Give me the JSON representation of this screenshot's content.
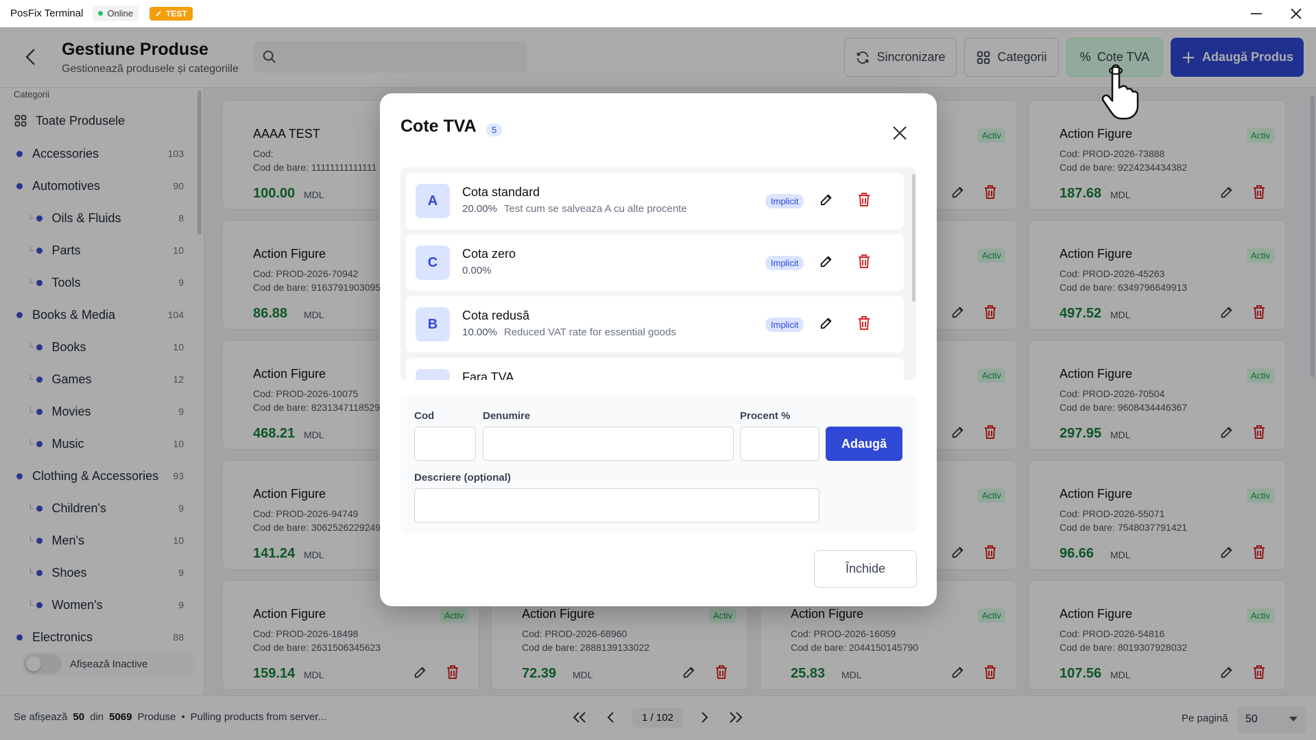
{
  "titlebar": {
    "app_title": "PosFix Terminal",
    "status": "Online",
    "env_badge": "TEST"
  },
  "header": {
    "title": "Gestiune Produse",
    "subtitle": "Gestionează produsele și categoriile",
    "search_placeholder": ""
  },
  "buttons": {
    "sync": "Sincronizare",
    "categories": "Categorii",
    "vat": "Cote TVA",
    "add_product": "Adaugă Produs"
  },
  "sidebar": {
    "label": "Categorii",
    "all_products": "Toate Produsele",
    "items": [
      {
        "label": "Accessories",
        "count": "103",
        "child": false
      },
      {
        "label": "Automotives",
        "count": "90",
        "child": false
      },
      {
        "label": "Oils & Fluids",
        "count": "8",
        "child": true
      },
      {
        "label": "Parts",
        "count": "10",
        "child": true
      },
      {
        "label": "Tools",
        "count": "9",
        "child": true
      },
      {
        "label": "Books & Media",
        "count": "104",
        "child": false
      },
      {
        "label": "Books",
        "count": "10",
        "child": true
      },
      {
        "label": "Games",
        "count": "12",
        "child": true
      },
      {
        "label": "Movies",
        "count": "9",
        "child": true
      },
      {
        "label": "Music",
        "count": "10",
        "child": true
      },
      {
        "label": "Clothing & Accessories",
        "count": "93",
        "child": false
      },
      {
        "label": "Children's",
        "count": "9",
        "child": true
      },
      {
        "label": "Men's",
        "count": "10",
        "child": true
      },
      {
        "label": "Shoes",
        "count": "9",
        "child": true
      },
      {
        "label": "Women's",
        "count": "9",
        "child": true
      },
      {
        "label": "Electronics",
        "count": "88",
        "child": false
      }
    ],
    "show_inactive": "Afișează Inactive"
  },
  "labels": {
    "code": "Cod:",
    "barcode": "Cod de bare:",
    "currency": "MDL",
    "active": "Activ"
  },
  "products": [
    [
      {
        "name": "AAAA TEST",
        "code": "",
        "barcode": "11111111111111",
        "price": "100.00",
        "active": false
      },
      {
        "name": "",
        "code": "",
        "barcode": "",
        "price": "",
        "active": false
      },
      {
        "name": "",
        "code": "",
        "barcode": "",
        "price": "",
        "active": true
      },
      {
        "name": "Action Figure",
        "code": "PROD-2026-73888",
        "barcode": "9224234434382",
        "price": "187.68",
        "active": true
      }
    ],
    [
      {
        "name": "Action Figure",
        "code": "PROD-2026-70942",
        "barcode": "9163791903095",
        "price": "86.88",
        "active": false
      },
      {
        "name": "",
        "code": "",
        "barcode": "",
        "price": "",
        "active": false
      },
      {
        "name": "",
        "code": "",
        "barcode": "",
        "price": "",
        "active": true
      },
      {
        "name": "Action Figure",
        "code": "PROD-2026-45263",
        "barcode": "6349796649913",
        "price": "497.52",
        "active": true
      }
    ],
    [
      {
        "name": "Action Figure",
        "code": "PROD-2026-10075",
        "barcode": "8231347118529",
        "price": "468.21",
        "active": false
      },
      {
        "name": "",
        "code": "",
        "barcode": "",
        "price": "",
        "active": false
      },
      {
        "name": "",
        "code": "",
        "barcode": "",
        "price": "",
        "active": true
      },
      {
        "name": "Action Figure",
        "code": "PROD-2026-70504",
        "barcode": "9608434446367",
        "price": "297.95",
        "active": true
      }
    ],
    [
      {
        "name": "Action Figure",
        "code": "PROD-2026-94749",
        "barcode": "3062526229249",
        "price": "141.24",
        "active": false
      },
      {
        "name": "",
        "code": "",
        "barcode": "",
        "price": "",
        "active": false
      },
      {
        "name": "",
        "code": "",
        "barcode": "",
        "price": "",
        "active": true
      },
      {
        "name": "Action Figure",
        "code": "PROD-2026-55071",
        "barcode": "7548037791421",
        "price": "96.66",
        "active": true
      }
    ],
    [
      {
        "name": "Action Figure",
        "code": "PROD-2026-18498",
        "barcode": "2631506345623",
        "price": "159.14",
        "active": true
      },
      {
        "name": "Action Figure",
        "code": "PROD-2026-68960",
        "barcode": "2888139133022",
        "price": "72.39",
        "active": true
      },
      {
        "name": "Action Figure",
        "code": "PROD-2026-16059",
        "barcode": "2044150145790",
        "price": "25.83",
        "active": true
      },
      {
        "name": "Action Figure",
        "code": "PROD-2026-54816",
        "barcode": "8019307928032",
        "price": "107.56",
        "active": true
      }
    ]
  ],
  "footer": {
    "showing": "Se afișează",
    "shown": "50",
    "of": "din",
    "total": "5069",
    "products_word": "Produse",
    "separator": "•",
    "status": "Pulling products from server...",
    "page": "1",
    "page_sep": "/",
    "page_total": "102",
    "per_page_label": "Pe pagină",
    "per_page_value": "50"
  },
  "modal": {
    "title": "Cote TVA",
    "count": "5",
    "rates": [
      {
        "letter": "A",
        "name": "Cota standard",
        "percent": "20.00%",
        "description": "Test cum se salveaza A cu alte procente",
        "badge": "Implicit"
      },
      {
        "letter": "C",
        "name": "Cota zero",
        "percent": "0.00%",
        "description": "",
        "badge": "Implicit"
      },
      {
        "letter": "B",
        "name": "Cota redusă",
        "percent": "10.00%",
        "description": "Reduced VAT rate for essential goods",
        "badge": "Implicit"
      },
      {
        "letter": "",
        "name": "Fara TVA",
        "percent": "",
        "description": "",
        "badge": ""
      }
    ],
    "form": {
      "code_label": "Cod",
      "name_label": "Denumire",
      "percent_label": "Procent %",
      "description_label": "Descriere (opțional)",
      "add_button": "Adaugă",
      "code_value": "",
      "name_value": "",
      "percent_value": "",
      "description_value": ""
    },
    "close_button": "Închide"
  },
  "colors": {
    "primary": "#2f48d6",
    "success": "#15803d",
    "danger": "#dc2626",
    "warning": "#f59e0b"
  }
}
